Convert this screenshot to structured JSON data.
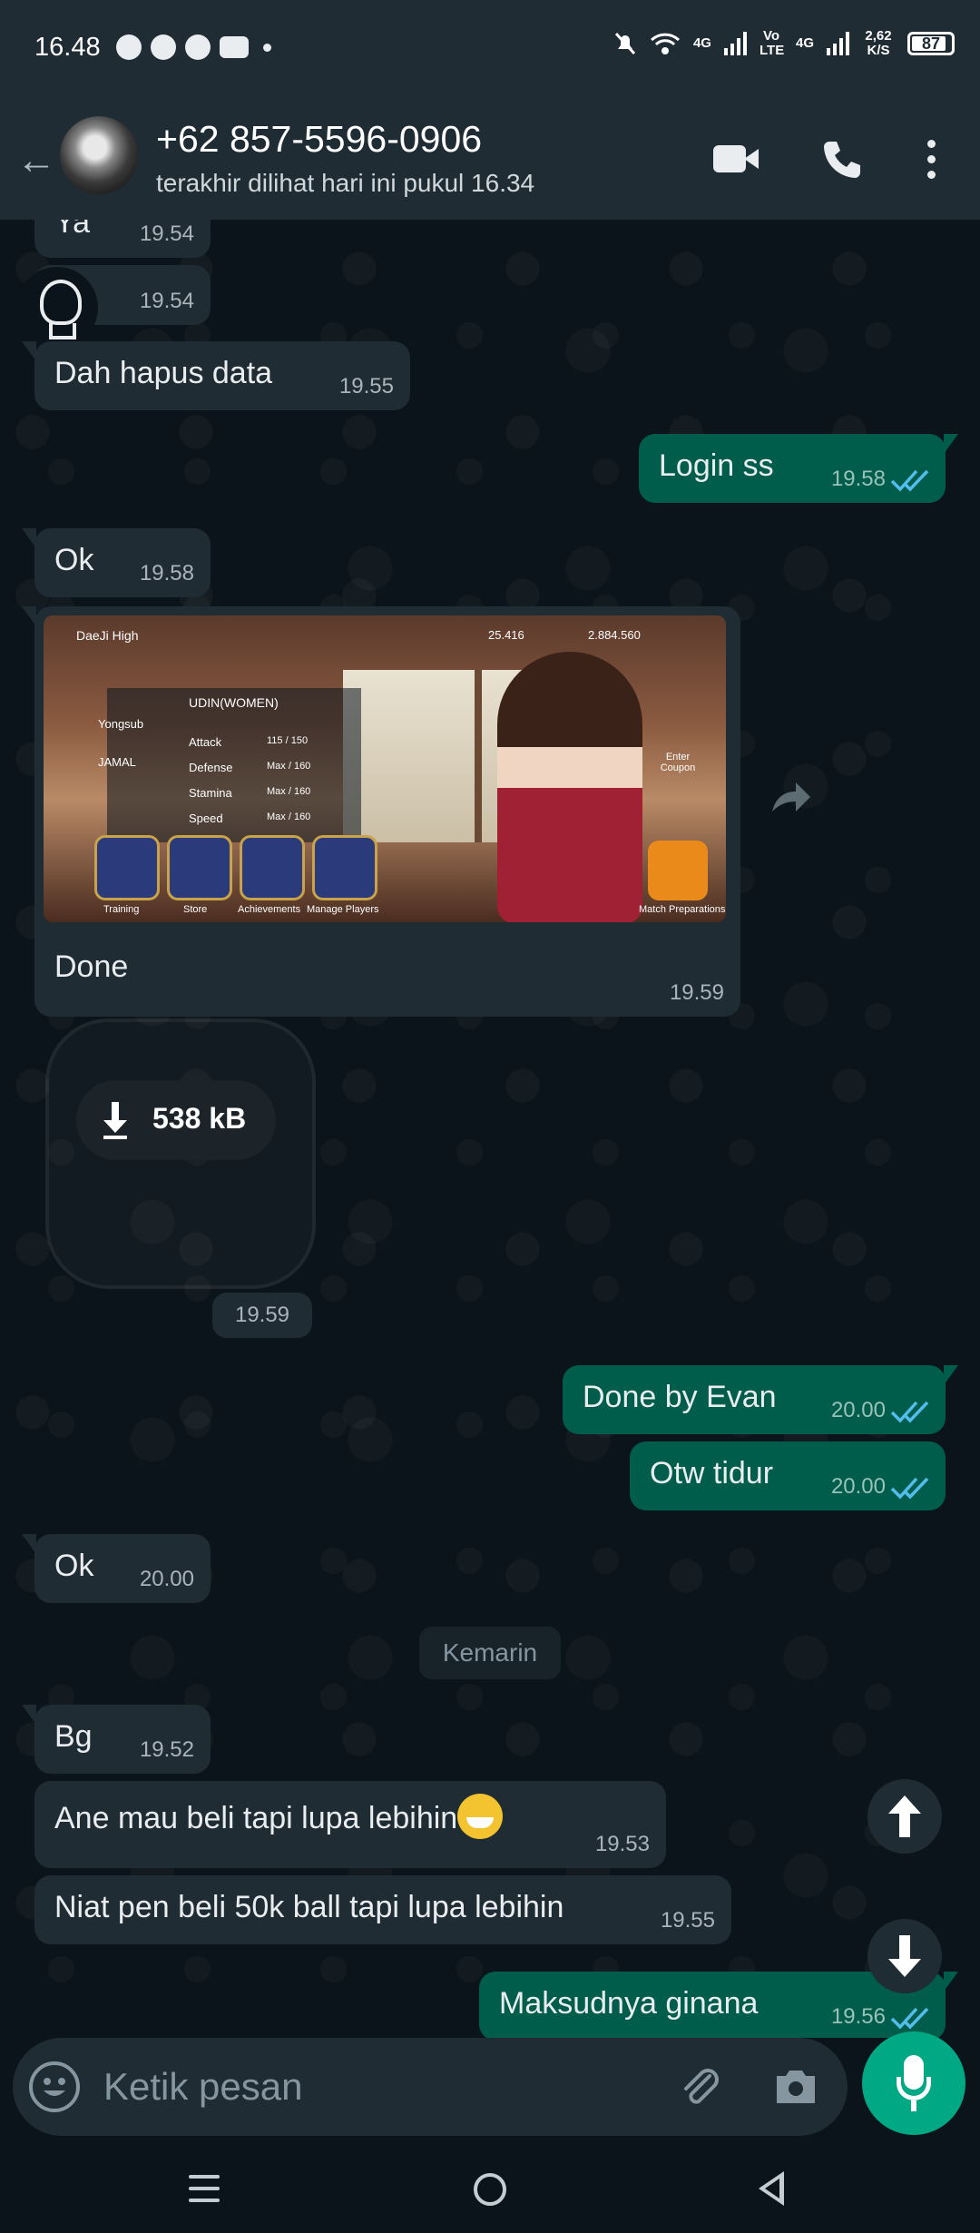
{
  "status_bar": {
    "time": "16.48",
    "net_4g_1": "4G",
    "volte": "Vo LTE",
    "net_4g_2": "4G",
    "speed": "2,62 K/S",
    "battery": "87"
  },
  "header": {
    "contact_name": "+62 857-5596-0906",
    "last_seen": "terakhir dilihat hari ini pukul 16.34"
  },
  "messages": [
    {
      "dir": "in",
      "text": "Ya",
      "time": "19.54"
    },
    {
      "dir": "in",
      "text": "",
      "time": "19.54",
      "kind": "sticker-icon"
    },
    {
      "dir": "in",
      "text": "Dah hapus data",
      "time": "19.55"
    },
    {
      "dir": "out",
      "text": "Login ss",
      "time": "19.58",
      "status": "read"
    },
    {
      "dir": "in",
      "text": "Ok",
      "time": "19.58"
    },
    {
      "dir": "in",
      "kind": "image",
      "caption": "Done",
      "time": "19.59"
    },
    {
      "dir": "in",
      "kind": "sticker-download",
      "size": "538 kB",
      "time": "19.59"
    },
    {
      "dir": "out",
      "text": "Done by Evan",
      "time": "20.00",
      "status": "read"
    },
    {
      "dir": "out",
      "text": "Otw tidur",
      "time": "20.00",
      "status": "read"
    },
    {
      "dir": "in",
      "text": "Ok",
      "time": "20.00"
    },
    {
      "kind": "date-divider",
      "text": "Kemarin"
    },
    {
      "dir": "in",
      "text": "Bg",
      "time": "19.52"
    },
    {
      "dir": "in",
      "text": "Ane mau beli tapi lupa lebihin",
      "time": "19.53",
      "emoji": "grinning-face"
    },
    {
      "dir": "in",
      "text": "Niat pen beli 50k ball tapi lupa lebihin",
      "time": "19.55"
    },
    {
      "dir": "out",
      "text": "Maksudnya ginana",
      "time": "19.56",
      "status": "read"
    }
  ],
  "game_screenshot": {
    "school": "DaeJi High",
    "currency_1": "25.416",
    "currency_2": "2.884.560",
    "player_name": "UDIN(WOMEN)",
    "roster_1": "Yongsub",
    "roster_2": "JAMAL",
    "stats": [
      "Attack",
      "Defense",
      "Stamina",
      "Speed"
    ],
    "stat_values": [
      "115 / 150",
      "Max / 160",
      "Max / 160",
      "Max / 160"
    ],
    "menu": [
      "Training",
      "Store",
      "Achievements",
      "Manage Players"
    ],
    "coupon": "Enter Coupon",
    "match": "Match Preparations"
  },
  "input": {
    "placeholder": "Ketik pesan"
  },
  "colors": {
    "incoming_bubble": "#202c33",
    "outgoing_bubble": "#005c4b",
    "read_ticks": "#53bdeb",
    "accent": "#00a884"
  },
  "icons": [
    "back-arrow-icon",
    "video-call-icon",
    "phone-icon",
    "more-options-icon",
    "forward-icon",
    "download-icon",
    "scroll-up-icon",
    "scroll-down-icon",
    "emoji-icon",
    "attach-icon",
    "camera-icon",
    "mic-icon"
  ]
}
